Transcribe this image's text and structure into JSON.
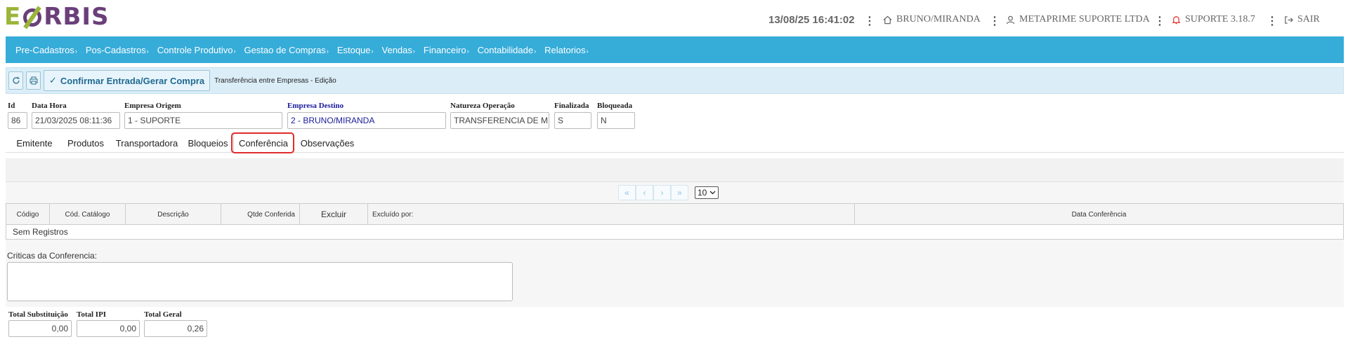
{
  "header": {
    "logo_e": "E",
    "logo_rest": "RBIS",
    "datetime": "13/08/25 16:41:02",
    "location": "BRUNO/MIRANDA",
    "company": "METAPRIME SUPORTE LTDA",
    "support": "SUPORTE 3.18.7",
    "logout": "SAIR"
  },
  "nav": {
    "items": [
      "Pre-Cadastros",
      "Pos-Cadastros",
      "Controle Produtivo",
      "Gestao de Compras",
      "Estoque",
      "Vendas",
      "Financeiro",
      "Contabilidade",
      "Relatorios"
    ],
    "caret": "›"
  },
  "toolbar": {
    "confirm_label": "Confirmar Entrada/Gerar Compra",
    "title": "Transferência entre Empresas - Edição"
  },
  "form": {
    "id_label": "Id",
    "id_value": "86",
    "datahora_label": "Data Hora",
    "datahora_value": "21/03/2025 08:11:36",
    "origem_label": "Empresa Origem",
    "origem_value": "1 - SUPORTE",
    "destino_label": "Empresa Destino",
    "destino_value": "2 - BRUNO/MIRANDA",
    "natureza_label": "Natureza Operação",
    "natureza_value": "TRANSFERENCIA DE MERCADORIAS",
    "finalizada_label": "Finalizada",
    "finalizada_value": "S",
    "bloqueada_label": "Bloqueada",
    "bloqueada_value": "N"
  },
  "tabs": [
    "Emitente",
    "Produtos",
    "Transportadora",
    "Bloqueios",
    "Conferência",
    "Observações"
  ],
  "active_tab": "Conferência",
  "pager": {
    "first": "«",
    "prev": "‹",
    "next": "›",
    "last": "»",
    "page_size": "10"
  },
  "grid": {
    "columns": [
      "Código",
      "Cód. Catálogo",
      "Descrição",
      "Qtde Conferida",
      "Excluir",
      "Excluído por:",
      "Data Conferência"
    ],
    "empty_text": "Sem Registros"
  },
  "criticas_label": "Criticas da Conferencia:",
  "totals": {
    "subst_label": "Total Substituição",
    "subst_value": "0,00",
    "ipi_label": "Total IPI",
    "ipi_value": "0,00",
    "geral_label": "Total Geral",
    "geral_value": "0,26"
  },
  "colors": {
    "nav_bg": "#36acd9",
    "toolbar_bg": "#dbeef8",
    "logo_green": "#9bb53a",
    "logo_purple": "#6b3f79",
    "highlight": "#e02b2b",
    "destino_blue": "#1a1a9c"
  }
}
